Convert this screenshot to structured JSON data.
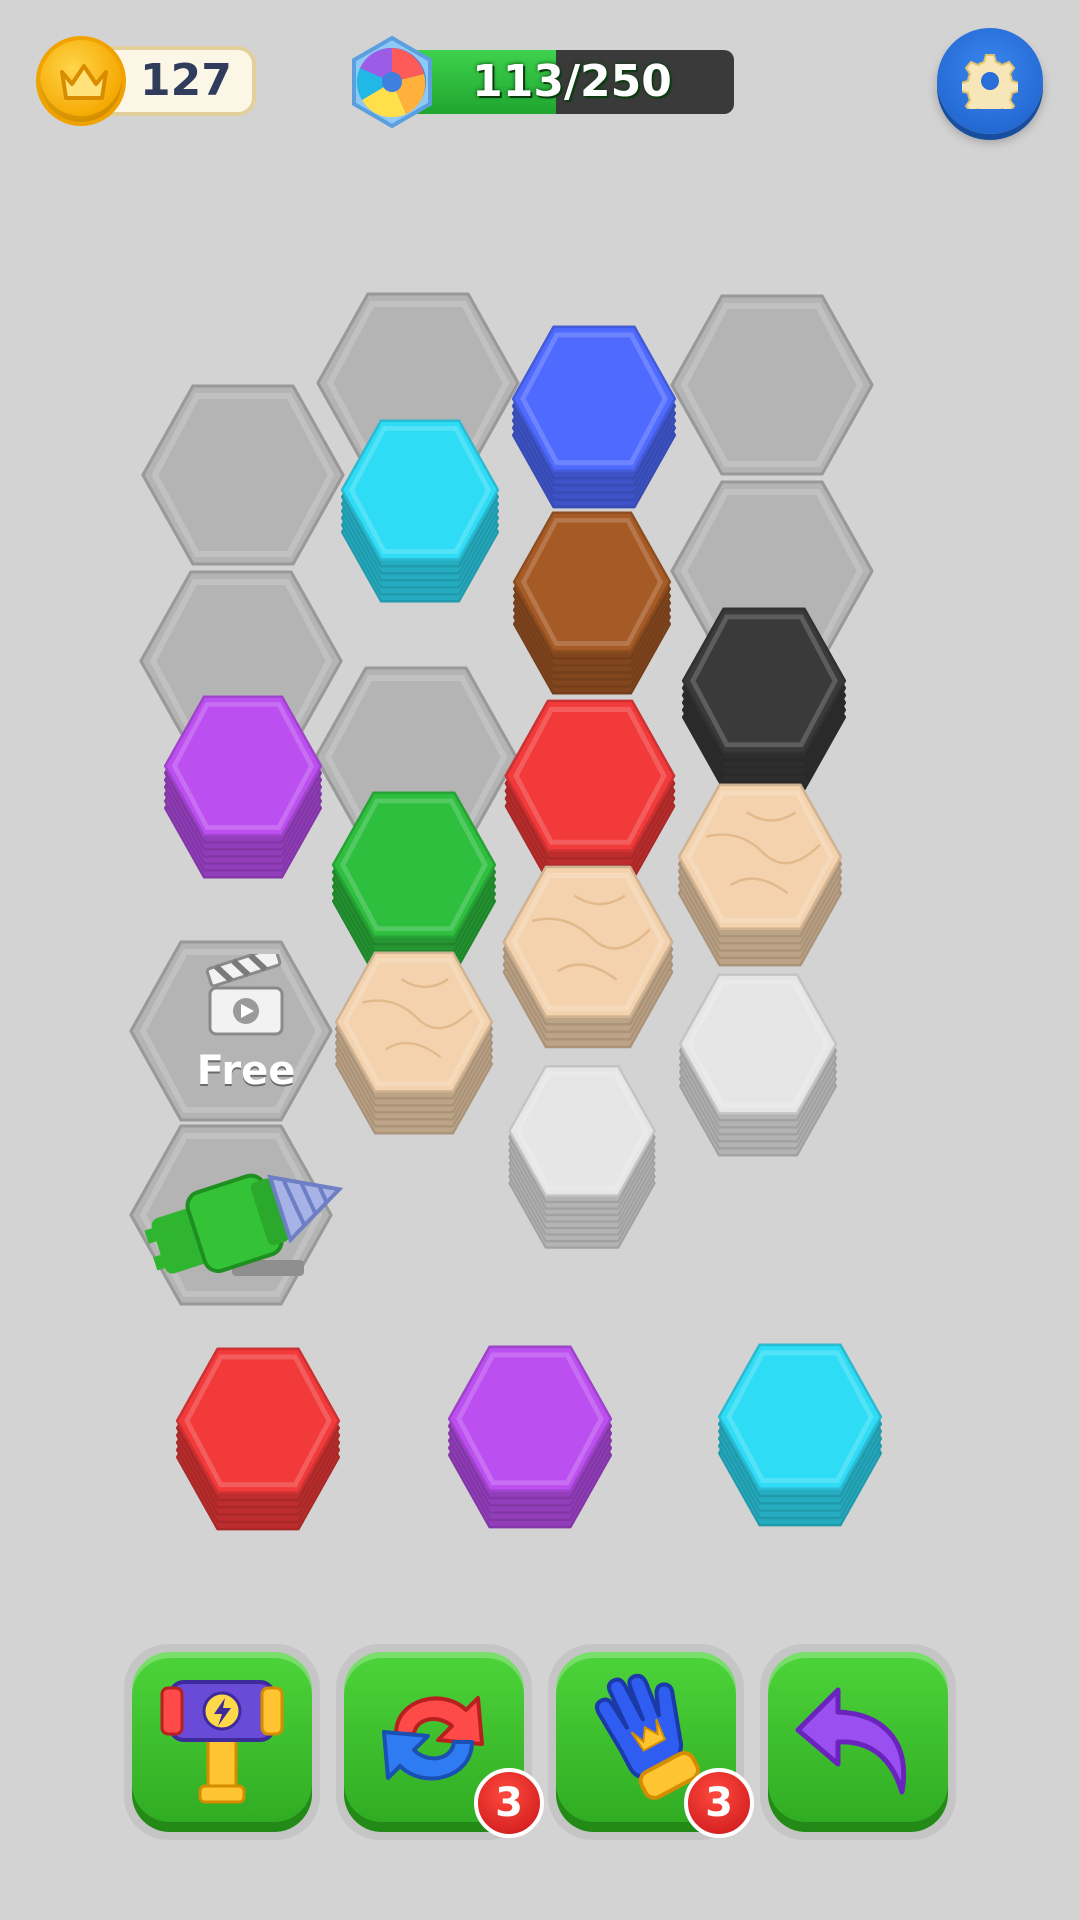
{
  "header": {
    "coins": "127",
    "progress": {
      "text": "113/250",
      "current": 113,
      "max": 250
    },
    "settings_icon": "gear-icon"
  },
  "colors": {
    "empty": "#b4b4b4",
    "blue": "#4f6bff",
    "cyan": "#2fdcf6",
    "brown": "#a65a25",
    "black": "#3a3a3a",
    "purple": "#bb4fef",
    "red": "#f23a3a",
    "green": "#2ebf3f",
    "marble": "#f3d2ad",
    "white": "#e6e6e6"
  },
  "board": {
    "free_cell_label": "Free",
    "free_cell_icon": "clapperboard-icon",
    "drill_icon": "drill-icon"
  },
  "tray": [
    {
      "color": "red",
      "layers": 6
    },
    {
      "color": "purple",
      "layers": 6
    },
    {
      "color": "cyan",
      "layers": 6
    }
  ],
  "tools": [
    {
      "name": "hammer-icon",
      "count": null
    },
    {
      "name": "swap-arrows-icon",
      "count": "3"
    },
    {
      "name": "glove-icon",
      "count": "3"
    },
    {
      "name": "undo-arrow-icon",
      "count": null
    }
  ]
}
